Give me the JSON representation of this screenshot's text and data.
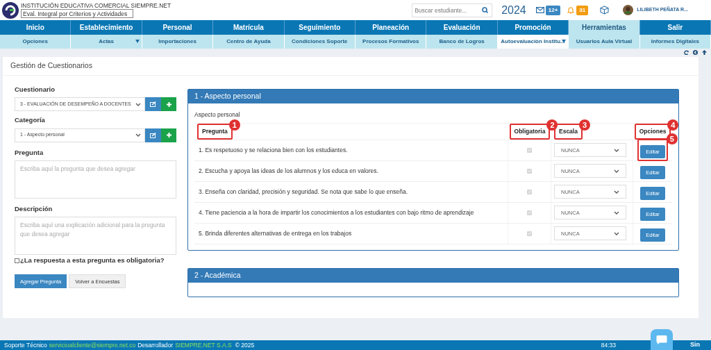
{
  "header": {
    "institution": "INSTITUCIÓN EDUCATIVA COMERCIAL SIEMPRE.NET",
    "mode_select": "Eval. Integral por Criterios y Actividades",
    "search": {
      "placeholder": "Buscar estudiante..."
    },
    "year": "2024",
    "messages_badge": "12+",
    "notifications_badge": "31",
    "user": "LILIBETH PEÑATA R..."
  },
  "nav": [
    {
      "label": "Inicio",
      "selected": false
    },
    {
      "label": "Establecimiento",
      "selected": false
    },
    {
      "label": "Personal",
      "selected": false
    },
    {
      "label": "Matrícula",
      "selected": false
    },
    {
      "label": "Seguimiento",
      "selected": false
    },
    {
      "label": "Planeación",
      "selected": false
    },
    {
      "label": "Evaluación",
      "selected": false
    },
    {
      "label": "Promoción",
      "selected": false
    },
    {
      "label": "Herramientas",
      "selected": true
    },
    {
      "label": "Salir",
      "selected": false
    }
  ],
  "subnav": [
    {
      "label": "Opciones",
      "selected": false,
      "dropdown": false
    },
    {
      "label": "Actas",
      "selected": false,
      "dropdown": true
    },
    {
      "label": "Importaciones",
      "selected": false,
      "dropdown": false
    },
    {
      "label": "Centro de Ayuda",
      "selected": false,
      "dropdown": false
    },
    {
      "label": "Condiciones Soporte",
      "selected": false,
      "dropdown": false
    },
    {
      "label": "Procesos Formativos",
      "selected": false,
      "dropdown": false
    },
    {
      "label": "Banco de Logros",
      "selected": false,
      "dropdown": false
    },
    {
      "label": "Autoevaluación Institu...",
      "selected": true,
      "dropdown": true
    },
    {
      "label": "Usuarios Aula Virtual",
      "selected": false,
      "dropdown": false
    },
    {
      "label": "Informes Digitales",
      "selected": false,
      "dropdown": false
    }
  ],
  "panel": {
    "title": "Gestión de Cuestionarios"
  },
  "form": {
    "questionnaire": {
      "label": "Cuestionario",
      "value": "3 - EVALUACIÓN DE DESEMPEÑO A DOCENTES"
    },
    "category": {
      "label": "Categoría",
      "value": "1 - Aspecto personal"
    },
    "question": {
      "label": "Pregunta",
      "placeholder": "Escriba aquí la pregunta que desea agregar"
    },
    "description": {
      "label": "Descripción",
      "placeholder": "Escriba aquí una explicación adicional para la pregunta que desea agregar"
    },
    "required": {
      "label": "¿La respuesta a esta pregunta es obligatoria?",
      "checked": false
    },
    "buttons": [
      "Agregar Pregunta",
      "Volver a Encuestas"
    ]
  },
  "categories": [
    {
      "title": "1 - Aspecto personal",
      "subtitle": "Aspecto personal",
      "columns": [
        {
          "label": "Pregunta",
          "callout": "1"
        },
        {
          "label": "Obligatoria",
          "callout": "2"
        },
        {
          "label": "Escala",
          "callout": "3"
        },
        {
          "label": "Opciones",
          "callout": "4"
        }
      ],
      "rows": [
        {
          "question": "1. Es respetuoso y se relaciona bien con los estudiantes.",
          "required": true,
          "scale": "NUNCA",
          "action": "Editar",
          "callout": "5"
        },
        {
          "question": "2. Escucha y apoya las ideas de los alumnos y los educa en valores.",
          "required": true,
          "scale": "NUNCA",
          "action": "Editar"
        },
        {
          "question": "3. Enseña con claridad, precisión y seguridad. Se nota que sabe lo que enseña.",
          "required": true,
          "scale": "NUNCA",
          "action": "Editar"
        },
        {
          "question": "4. Tiene paciencia a la hora de impartir los conocimientos a los estudiantes con bajo ritmo de aprendizaje",
          "required": true,
          "scale": "NUNCA",
          "action": "Editar"
        },
        {
          "question": "5. Brinda diferentes alternativas de entrega en los trabajos",
          "required": true,
          "scale": "NUNCA",
          "action": "Editar"
        }
      ]
    },
    {
      "title": "2 - Académica"
    }
  ],
  "footer": {
    "support_label": "Soporte Técnico",
    "email": "servicioalcliente@siempre.net.co",
    "developer_label": "Desarrollador",
    "developer": "SIEMPRE.NET S.A.S",
    "copyright": "© 2025",
    "timer": "84:33",
    "brand": "Sin"
  }
}
